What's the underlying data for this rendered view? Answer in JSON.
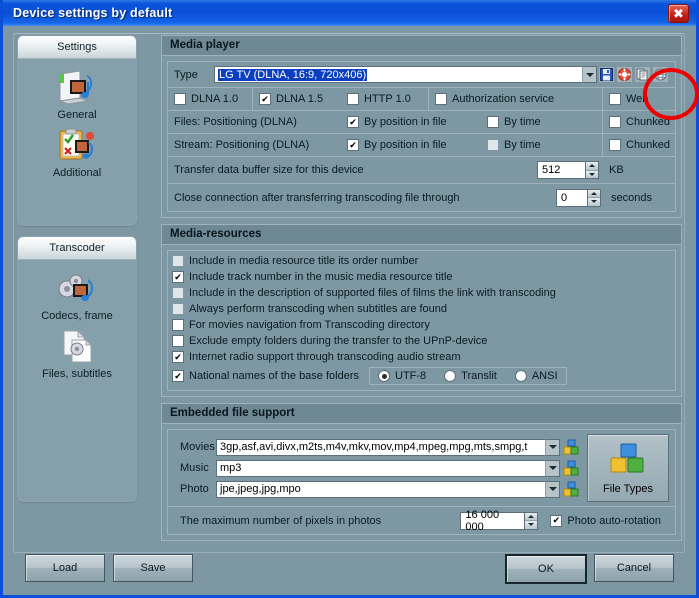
{
  "window": {
    "title": "Device settings by default",
    "close_label": "✖"
  },
  "sidebar": {
    "groups": [
      {
        "header": "Settings",
        "items": [
          {
            "label": "General",
            "icon": "media-folder-icon"
          },
          {
            "label": "Additional",
            "icon": "clipboard-check-icon"
          }
        ]
      },
      {
        "header": "Transcoder",
        "items": [
          {
            "label": "Codecs, frame",
            "icon": "gears-media-icon"
          },
          {
            "label": "Files, subtitles",
            "icon": "file-gear-icon"
          }
        ]
      }
    ]
  },
  "media_player": {
    "title": "Media player",
    "type_label": "Type",
    "type_value": "LG TV (DLNA, 16:9, 720x406)",
    "toolbar_icons": [
      "save-icon",
      "lifebuoy-icon",
      "copy-icon",
      "globe-icon"
    ],
    "protocol_row": [
      {
        "label": "DLNA 1.0",
        "checked": false
      },
      {
        "label": "DLNA 1.5",
        "checked": true
      },
      {
        "label": "HTTP 1.0",
        "checked": false
      },
      {
        "label": "Authorization service",
        "checked": false
      },
      {
        "label": "Web",
        "checked": false
      }
    ],
    "files_row": {
      "label": "Files: Positioning (DLNA)",
      "by_position_label": "By position in file",
      "by_position_checked": true,
      "by_time_label": "By time",
      "by_time_checked": false,
      "chunked_label": "Chunked",
      "chunked_checked": false
    },
    "stream_row": {
      "label": "Stream: Positioning (DLNA)",
      "by_position_label": "By position in file",
      "by_position_checked": true,
      "by_time_label": "By time",
      "by_time_checked": false,
      "chunked_label": "Chunked",
      "chunked_checked": false
    },
    "buffer_row": {
      "label": "Transfer data buffer size for this device",
      "value": "512",
      "unit": "KB"
    },
    "close_conn_row": {
      "label": "Close connection after transferring transcoding file through",
      "value": "0",
      "unit": "seconds"
    }
  },
  "media_resources": {
    "title": "Media-resources",
    "items": [
      {
        "label": "Include in media resource title its order number",
        "checked": false
      },
      {
        "label": "Include track number in the music media resource title",
        "checked": true
      },
      {
        "label": "Include in the description of supported files of films the link with transcoding",
        "checked": false
      },
      {
        "label": "Always perform transcoding when subtitles are found",
        "checked": false
      },
      {
        "label": "For movies navigation from Transcoding directory",
        "checked": false
      },
      {
        "label": "Exclude empty folders during the transfer to the UPnP-device",
        "checked": false
      },
      {
        "label": "Internet radio support through transcoding audio stream",
        "checked": true
      }
    ],
    "national_names": {
      "label": "National names of the base folders",
      "checked": true,
      "options": [
        {
          "label": "UTF-8",
          "selected": true
        },
        {
          "label": "Translit",
          "selected": false
        },
        {
          "label": "ANSI",
          "selected": false
        }
      ]
    }
  },
  "embedded_file_support": {
    "title": "Embedded file support",
    "rows": [
      {
        "label": "Movies",
        "value": "3gp,asf,avi,divx,m2ts,m4v,mkv,mov,mp4,mpeg,mpg,mts,smpg,t"
      },
      {
        "label": "Music",
        "value": "mp3"
      },
      {
        "label": "Photo",
        "value": "jpe,jpeg,jpg,mpo"
      }
    ],
    "file_types_button": "File Types",
    "max_pixels": {
      "label": "The maximum number of pixels in photos",
      "value": "16 000 000"
    },
    "auto_rotation": {
      "label": "Photo auto-rotation",
      "checked": true
    }
  },
  "footer": {
    "load": "Load",
    "save": "Save",
    "ok": "OK",
    "cancel": "Cancel"
  },
  "colors": {
    "titlebar": "#0a4fd6",
    "background": "#7d98a3",
    "group_header": "#6e8894",
    "selection": "#0a3fc2",
    "annotation": "#ee0000"
  }
}
